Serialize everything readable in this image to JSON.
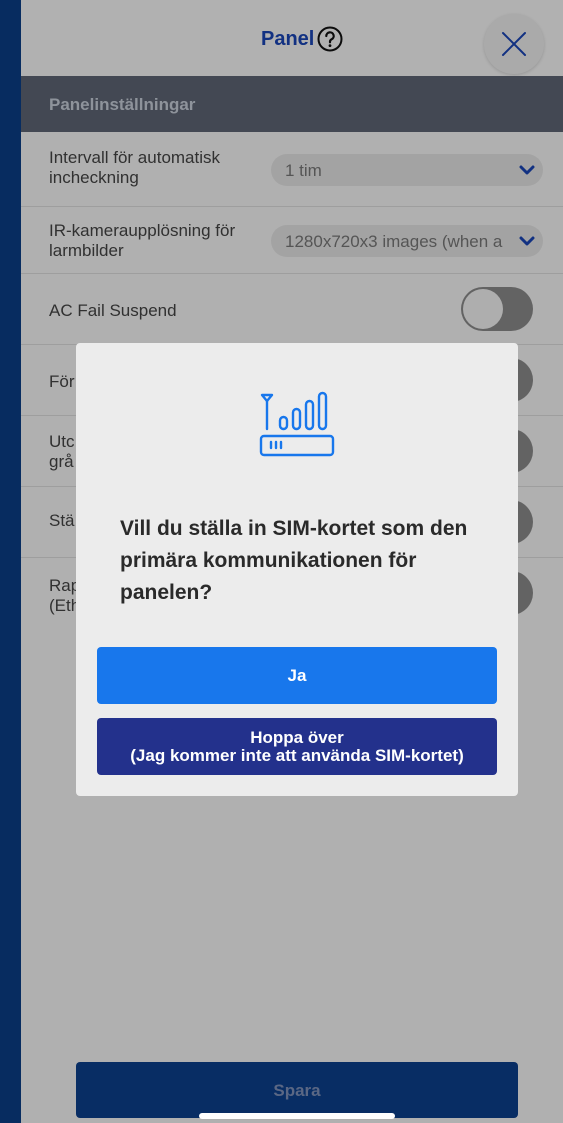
{
  "header": {
    "title": "Panel",
    "help_icon": "help-circle-icon",
    "close_icon": "close-icon"
  },
  "section": {
    "title": "Panelinställningar"
  },
  "settings": [
    {
      "label_line1": "Intervall för automatisk",
      "label_line2": "incheckning",
      "type": "select",
      "value": "1 tim"
    },
    {
      "label_line1": "IR-kameraupplösning för",
      "label_line2": "larmbilder",
      "type": "select",
      "value": "1280x720x3 images (when a"
    },
    {
      "label_line1": "AC Fail Suspend",
      "type": "toggle",
      "on": false
    },
    {
      "label_line1": "För",
      "type": "toggle",
      "on": false
    },
    {
      "label_line1": "Utc",
      "label_line2": "grå",
      "type": "toggle",
      "on": false
    },
    {
      "label_line1": "Stä",
      "type": "toggle",
      "on": false
    },
    {
      "label_line1": "Rap",
      "label_line2": "(Eth",
      "type": "toggle",
      "on": false
    }
  ],
  "footer": {
    "save_label": "Spara"
  },
  "modal": {
    "icon": "router-signal-icon",
    "question": "Vill du ställa in SIM-kortet som den primära kommunikationen för panelen?",
    "yes_label": "Ja",
    "skip_line1": "Hoppa över",
    "skip_line2": "(Jag kommer inte att använda SIM-kortet)"
  },
  "colors": {
    "brand_blue": "#1a45b5",
    "primary_button": "#1877ec",
    "secondary_button": "#23318c",
    "save_button": "#0c3f8b",
    "section_bar": "#5d6573"
  }
}
